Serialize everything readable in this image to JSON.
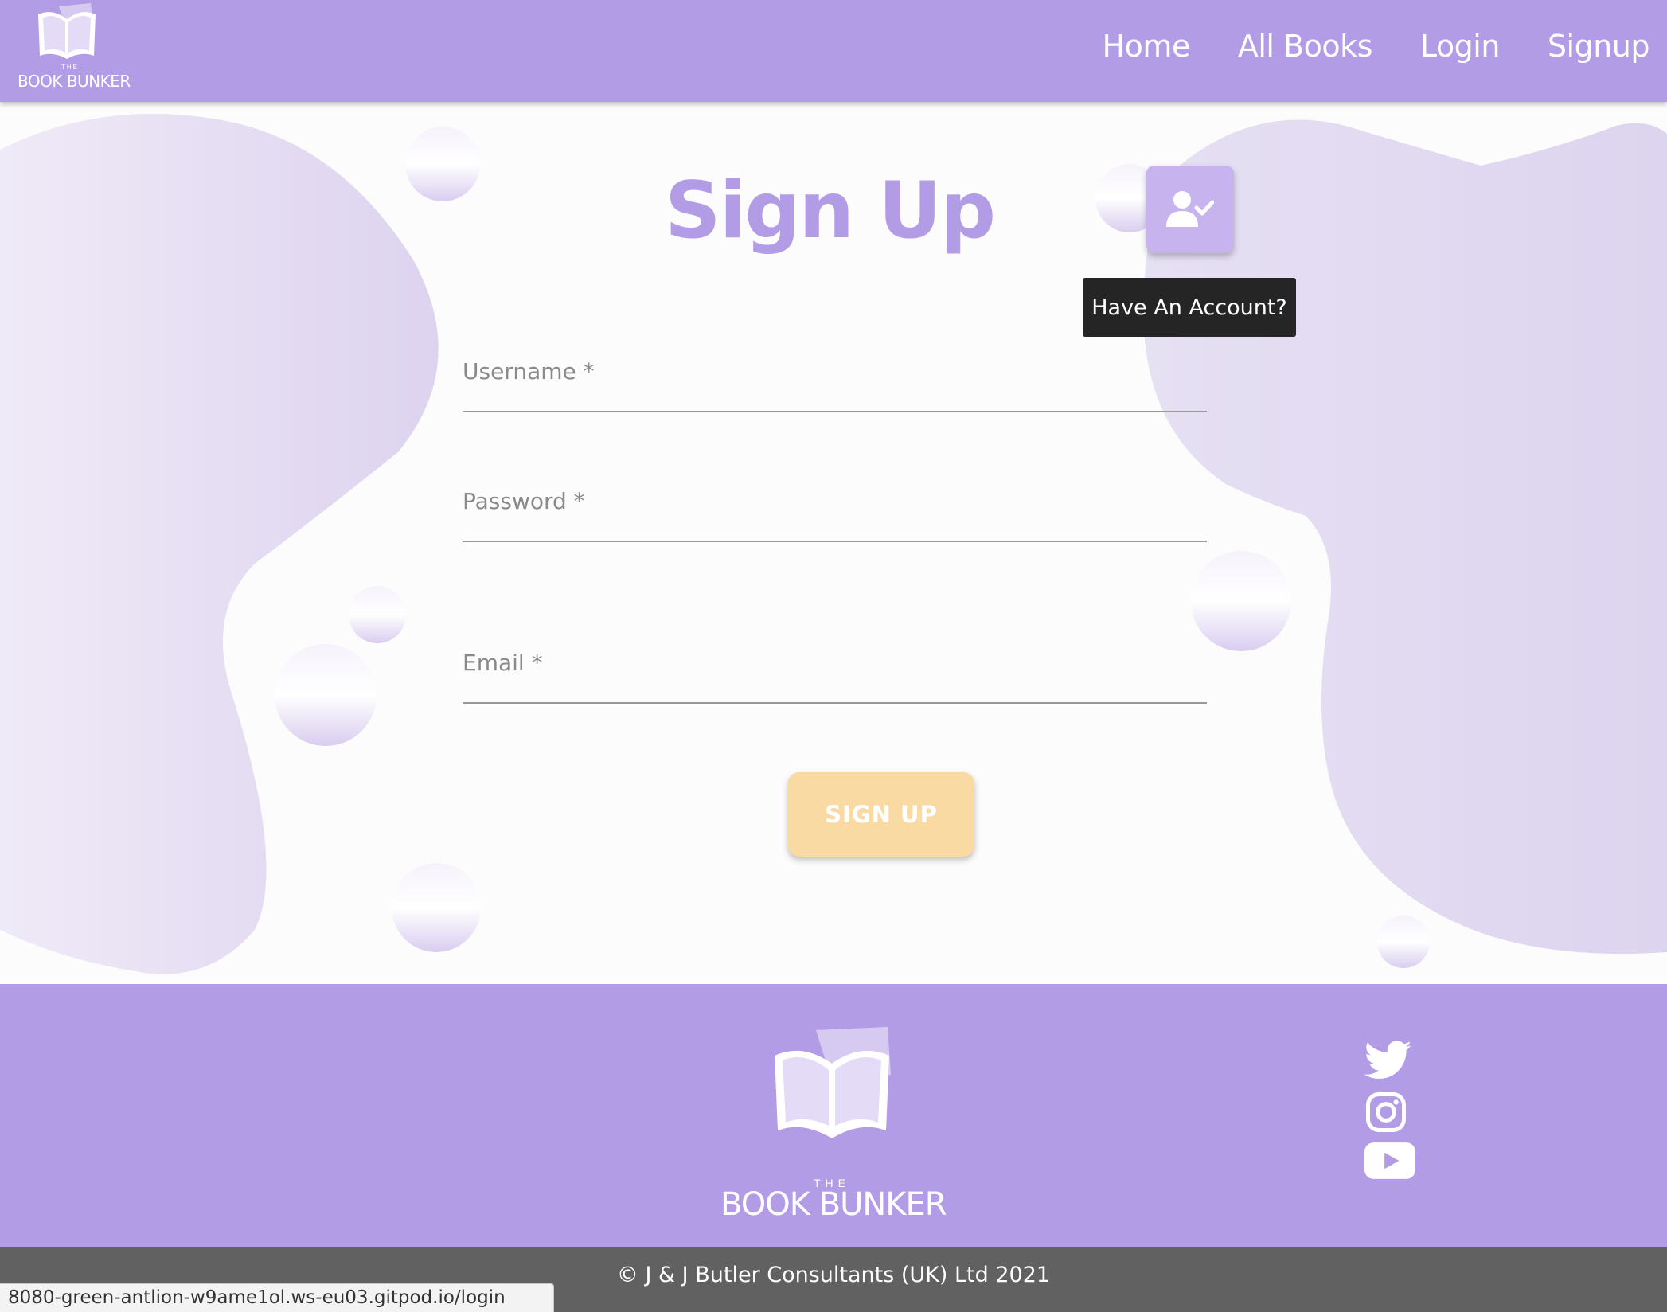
{
  "header": {
    "brand_the": "THE",
    "brand_name": "BOOK BUNKER",
    "nav": [
      {
        "label": "Home"
      },
      {
        "label": "All Books"
      },
      {
        "label": "Login"
      },
      {
        "label": "Signup"
      }
    ]
  },
  "main": {
    "title": "Sign Up",
    "account_button": {
      "icon": "user-check-icon",
      "tooltip": "Have An Account?"
    },
    "form": {
      "username": {
        "label": "Username *",
        "value": ""
      },
      "password": {
        "label": "Password *",
        "value": ""
      },
      "email": {
        "label": "Email *",
        "value": ""
      },
      "submit_label": "SIGN UP"
    }
  },
  "footer": {
    "brand_the": "THE",
    "brand_name": "BOOK BUNKER",
    "socials": [
      {
        "icon": "twitter-icon"
      },
      {
        "icon": "instagram-icon"
      },
      {
        "icon": "youtube-icon"
      }
    ],
    "copyright": "© J & J Butler Consultants (UK) Ltd 2021"
  },
  "status_bar": {
    "url": "8080-green-antlion-w9ame1ol.ws-eu03.gitpod.io/login"
  },
  "colors": {
    "primary": "#b39ce6",
    "accent": "#f9daa3",
    "footer_bar": "#616161",
    "tooltip_bg": "#252525"
  }
}
